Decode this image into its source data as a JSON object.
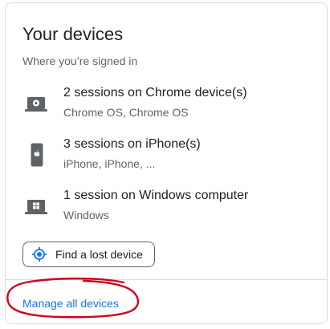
{
  "card": {
    "title": "Your devices",
    "subtitle": "Where you’re signed in"
  },
  "devices": [
    {
      "name": "2 sessions on Chrome device(s)",
      "detail": "Chrome OS, Chrome OS",
      "icon": "chrome-laptop-icon"
    },
    {
      "name": "3 sessions on iPhone(s)",
      "detail": "iPhone, iPhone, ...",
      "icon": "iphone-icon"
    },
    {
      "name": "1 session on Windows computer",
      "detail": "Windows",
      "icon": "windows-laptop-icon"
    }
  ],
  "find_device": {
    "label": "Find a lost device",
    "icon": "location-target-icon"
  },
  "footer": {
    "manage_label": "Manage all devices"
  },
  "colors": {
    "link": "#1a73e8",
    "text_primary": "#202124",
    "text_secondary": "#5f6368",
    "border": "#dadce0",
    "annotation": "#d0021b"
  }
}
